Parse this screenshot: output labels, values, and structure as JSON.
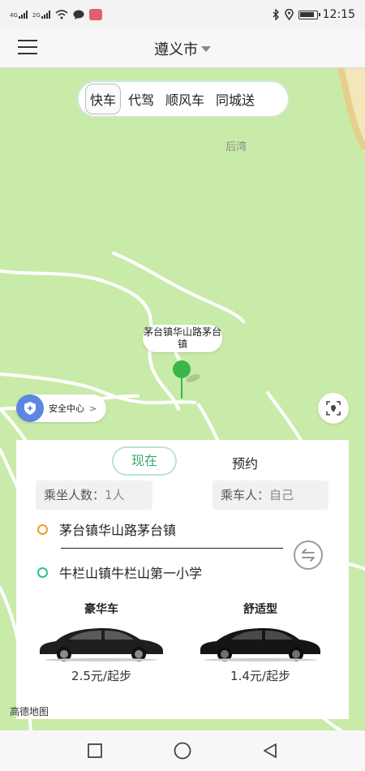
{
  "status_bar": {
    "time": "12:15",
    "sig1": "4G",
    "sig2": "2G",
    "icons": [
      "signal-icon",
      "wifi-icon",
      "message-icon",
      "app-notification-icon",
      "bluetooth-icon",
      "location-icon",
      "battery-icon"
    ]
  },
  "header": {
    "city": "遵义市"
  },
  "mode_tabs": [
    {
      "label": "快车",
      "active": true
    },
    {
      "label": "代驾",
      "active": false
    },
    {
      "label": "顺风车",
      "active": false
    },
    {
      "label": "同城送",
      "active": false
    }
  ],
  "map": {
    "place_label": "后湾",
    "pin_label": "茅台镇华山路茅台镇",
    "safety_center": "安全中心",
    "logo": "高德地图"
  },
  "panel": {
    "time_tabs": {
      "now": "现在",
      "reserve": "预约"
    },
    "passenger_count": {
      "label": "乘坐人数：",
      "value": "1人"
    },
    "rider": {
      "label": "乘车人：",
      "value": "自己"
    },
    "start_address": "茅台镇华山路茅台镇",
    "end_address": "牛栏山镇牛栏山第一小学",
    "cars": [
      {
        "name": "豪华车",
        "price": "2.5元/起步"
      },
      {
        "name": "舒适型",
        "price": "1.4元/起步"
      }
    ]
  },
  "colors": {
    "accent": "#3bb54a",
    "map_bg": "#c9eba9",
    "start_dot": "#f09a2a",
    "end_dot": "#2fbf93"
  }
}
